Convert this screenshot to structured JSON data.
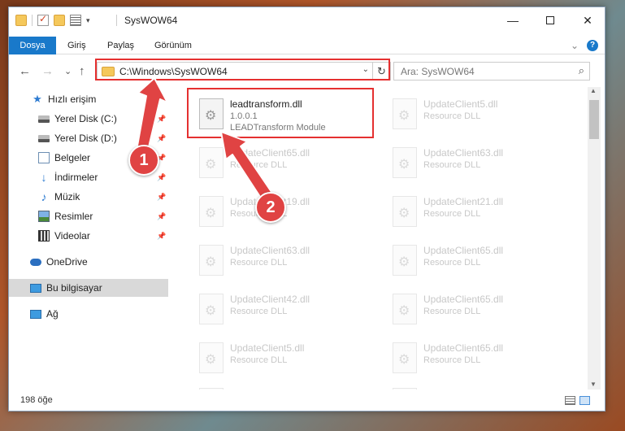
{
  "window": {
    "title": "SysWOW64",
    "controls": {
      "minimize": "—",
      "close": "✕"
    }
  },
  "ribbon": {
    "tabs": [
      "Dosya",
      "Giriş",
      "Paylaş",
      "Görünüm"
    ],
    "expand": "⌄",
    "help": "?"
  },
  "nav": {
    "back": "←",
    "forward": "→",
    "recent": "⌄",
    "up": "↑",
    "address": "C:\\Windows\\SysWOW64",
    "address_dropdown": "⌄",
    "refresh": "↻",
    "search_placeholder": "Ara: SysWOW64",
    "search_icon": "⌕"
  },
  "sidebar": {
    "items": [
      {
        "label": "Hızlı erişim",
        "icon": "star-icon",
        "pinned": false
      },
      {
        "label": "Yerel Disk (C:)",
        "icon": "drive-icon",
        "pinned": true
      },
      {
        "label": "Yerel Disk (D:)",
        "icon": "drive-icon",
        "pinned": true
      },
      {
        "label": "Belgeler",
        "icon": "documents-icon",
        "pinned": true
      },
      {
        "label": "İndirmeler",
        "icon": "download-icon",
        "pinned": true
      },
      {
        "label": "Müzik",
        "icon": "music-icon",
        "pinned": true
      },
      {
        "label": "Resimler",
        "icon": "pictures-icon",
        "pinned": true
      },
      {
        "label": "Videolar",
        "icon": "videos-icon",
        "pinned": true
      },
      {
        "label": "OneDrive",
        "icon": "cloud-icon",
        "pinned": false
      },
      {
        "label": "Bu bilgisayar",
        "icon": "pc-icon",
        "pinned": false
      },
      {
        "label": "Ağ",
        "icon": "network-icon",
        "pinned": false
      }
    ],
    "pin_glyph": "📌"
  },
  "files": [
    {
      "name": "leadtransform.dll",
      "line1": "1.0.0.1",
      "line2": "LEADTransform Module",
      "faded": false
    },
    {
      "name": "UpdateClient5.dll",
      "line1": "Resource DLL",
      "faded": true
    },
    {
      "name": "UpdateClient65.dll",
      "line1": "Resource DLL",
      "faded": true
    },
    {
      "name": "UpdateClient63.dll",
      "line1": "Resource DLL",
      "faded": true
    },
    {
      "name": "UpdateClient19.dll",
      "line1": "Resource DLL",
      "faded": true
    },
    {
      "name": "UpdateClient21.dll",
      "line1": "Resource DLL",
      "faded": true
    },
    {
      "name": "UpdateClient63.dll",
      "line1": "Resource DLL",
      "faded": true
    },
    {
      "name": "UpdateClient65.dll",
      "line1": "Resource DLL",
      "faded": true
    },
    {
      "name": "UpdateClient42.dll",
      "line1": "Resource DLL",
      "faded": true
    },
    {
      "name": "UpdateClient65.dll",
      "line1": "Resource DLL",
      "faded": true
    },
    {
      "name": "UpdateClient5.dll",
      "line1": "Resource DLL",
      "faded": true
    },
    {
      "name": "UpdateClient65.dll",
      "line1": "Resource DLL",
      "faded": true
    },
    {
      "name": "",
      "line1": "",
      "faded": true
    },
    {
      "name": "",
      "line1": "",
      "faded": true
    }
  ],
  "status": {
    "count": "198 öğe"
  },
  "annotations": {
    "badge1": "1",
    "badge2": "2",
    "color": "#e04343"
  }
}
